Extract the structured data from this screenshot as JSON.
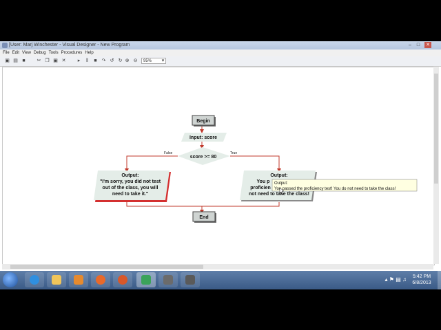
{
  "window": {
    "title": "[User: Marj Winchester - Visual Designer - New Program"
  },
  "menu": {
    "items": [
      "File",
      "Edit",
      "View",
      "Debug",
      "Tools",
      "Procedures",
      "Help"
    ]
  },
  "toolbar": {
    "zoom": "95%"
  },
  "flowchart": {
    "begin": "Begin",
    "input": "Input: score",
    "decision": "score >= 80",
    "false_label": "False",
    "true_label": "True",
    "output_left_title": "Output:",
    "output_left_line1": "\"I'm sorry, you did not test",
    "output_left_line2": "out of the class, you will",
    "output_left_line3": "need to take it.\"",
    "output_right_title": "Output:",
    "output_right_line1": "You p",
    "output_right_line2": "proficien",
    "output_right_line3": "not need to take the class!",
    "end": "End",
    "tooltip_line1": "Output:",
    "tooltip_line2": "You passed the proficiency test! You do not need to take the class!"
  },
  "taskbar": {
    "time": "5:42 PM",
    "date": "6/8/2013"
  },
  "colors": {
    "connector": "#c0392b",
    "shape_fill": "#e4ede8",
    "selected_shadow": "#d43030"
  }
}
